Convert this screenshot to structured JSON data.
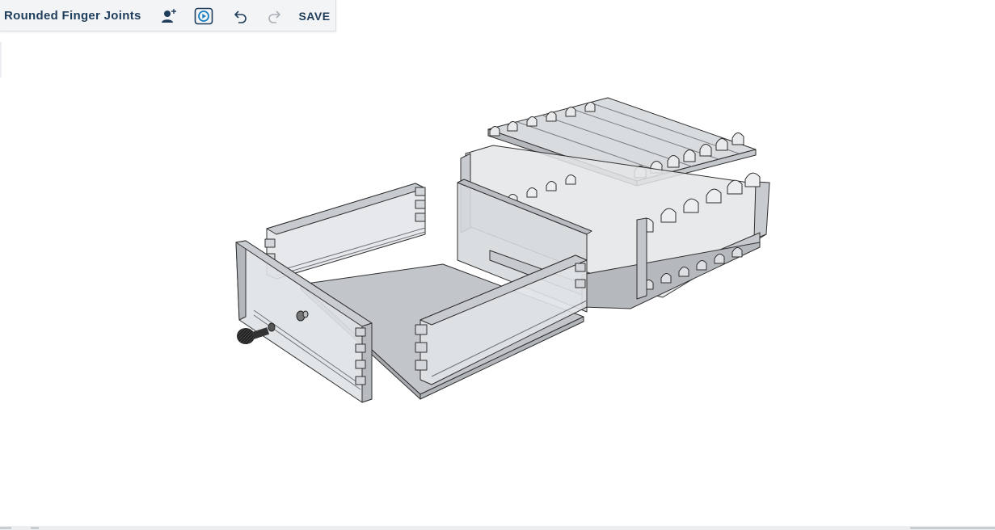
{
  "app": {
    "document_title": "Rounded Finger Joints",
    "save_label": "SAVE"
  },
  "toolbar": {
    "icons": [
      "add-collaborator-icon",
      "play-animation-icon",
      "undo-icon",
      "redo-icon"
    ],
    "redo_enabled": false
  },
  "colors": {
    "toolbar_bg": "#f3f4f6",
    "accent": "#1e3d5a",
    "play_accent": "#1a7fc1",
    "disabled": "#a9b1b9",
    "wood_light": "#e6e8ea",
    "wood_mid": "#cdd0d4",
    "wood_dark": "#a8acb1",
    "edge": "#2f2f2f"
  },
  "viewport": {
    "model": "exploded drawer with rounded finger joints"
  }
}
